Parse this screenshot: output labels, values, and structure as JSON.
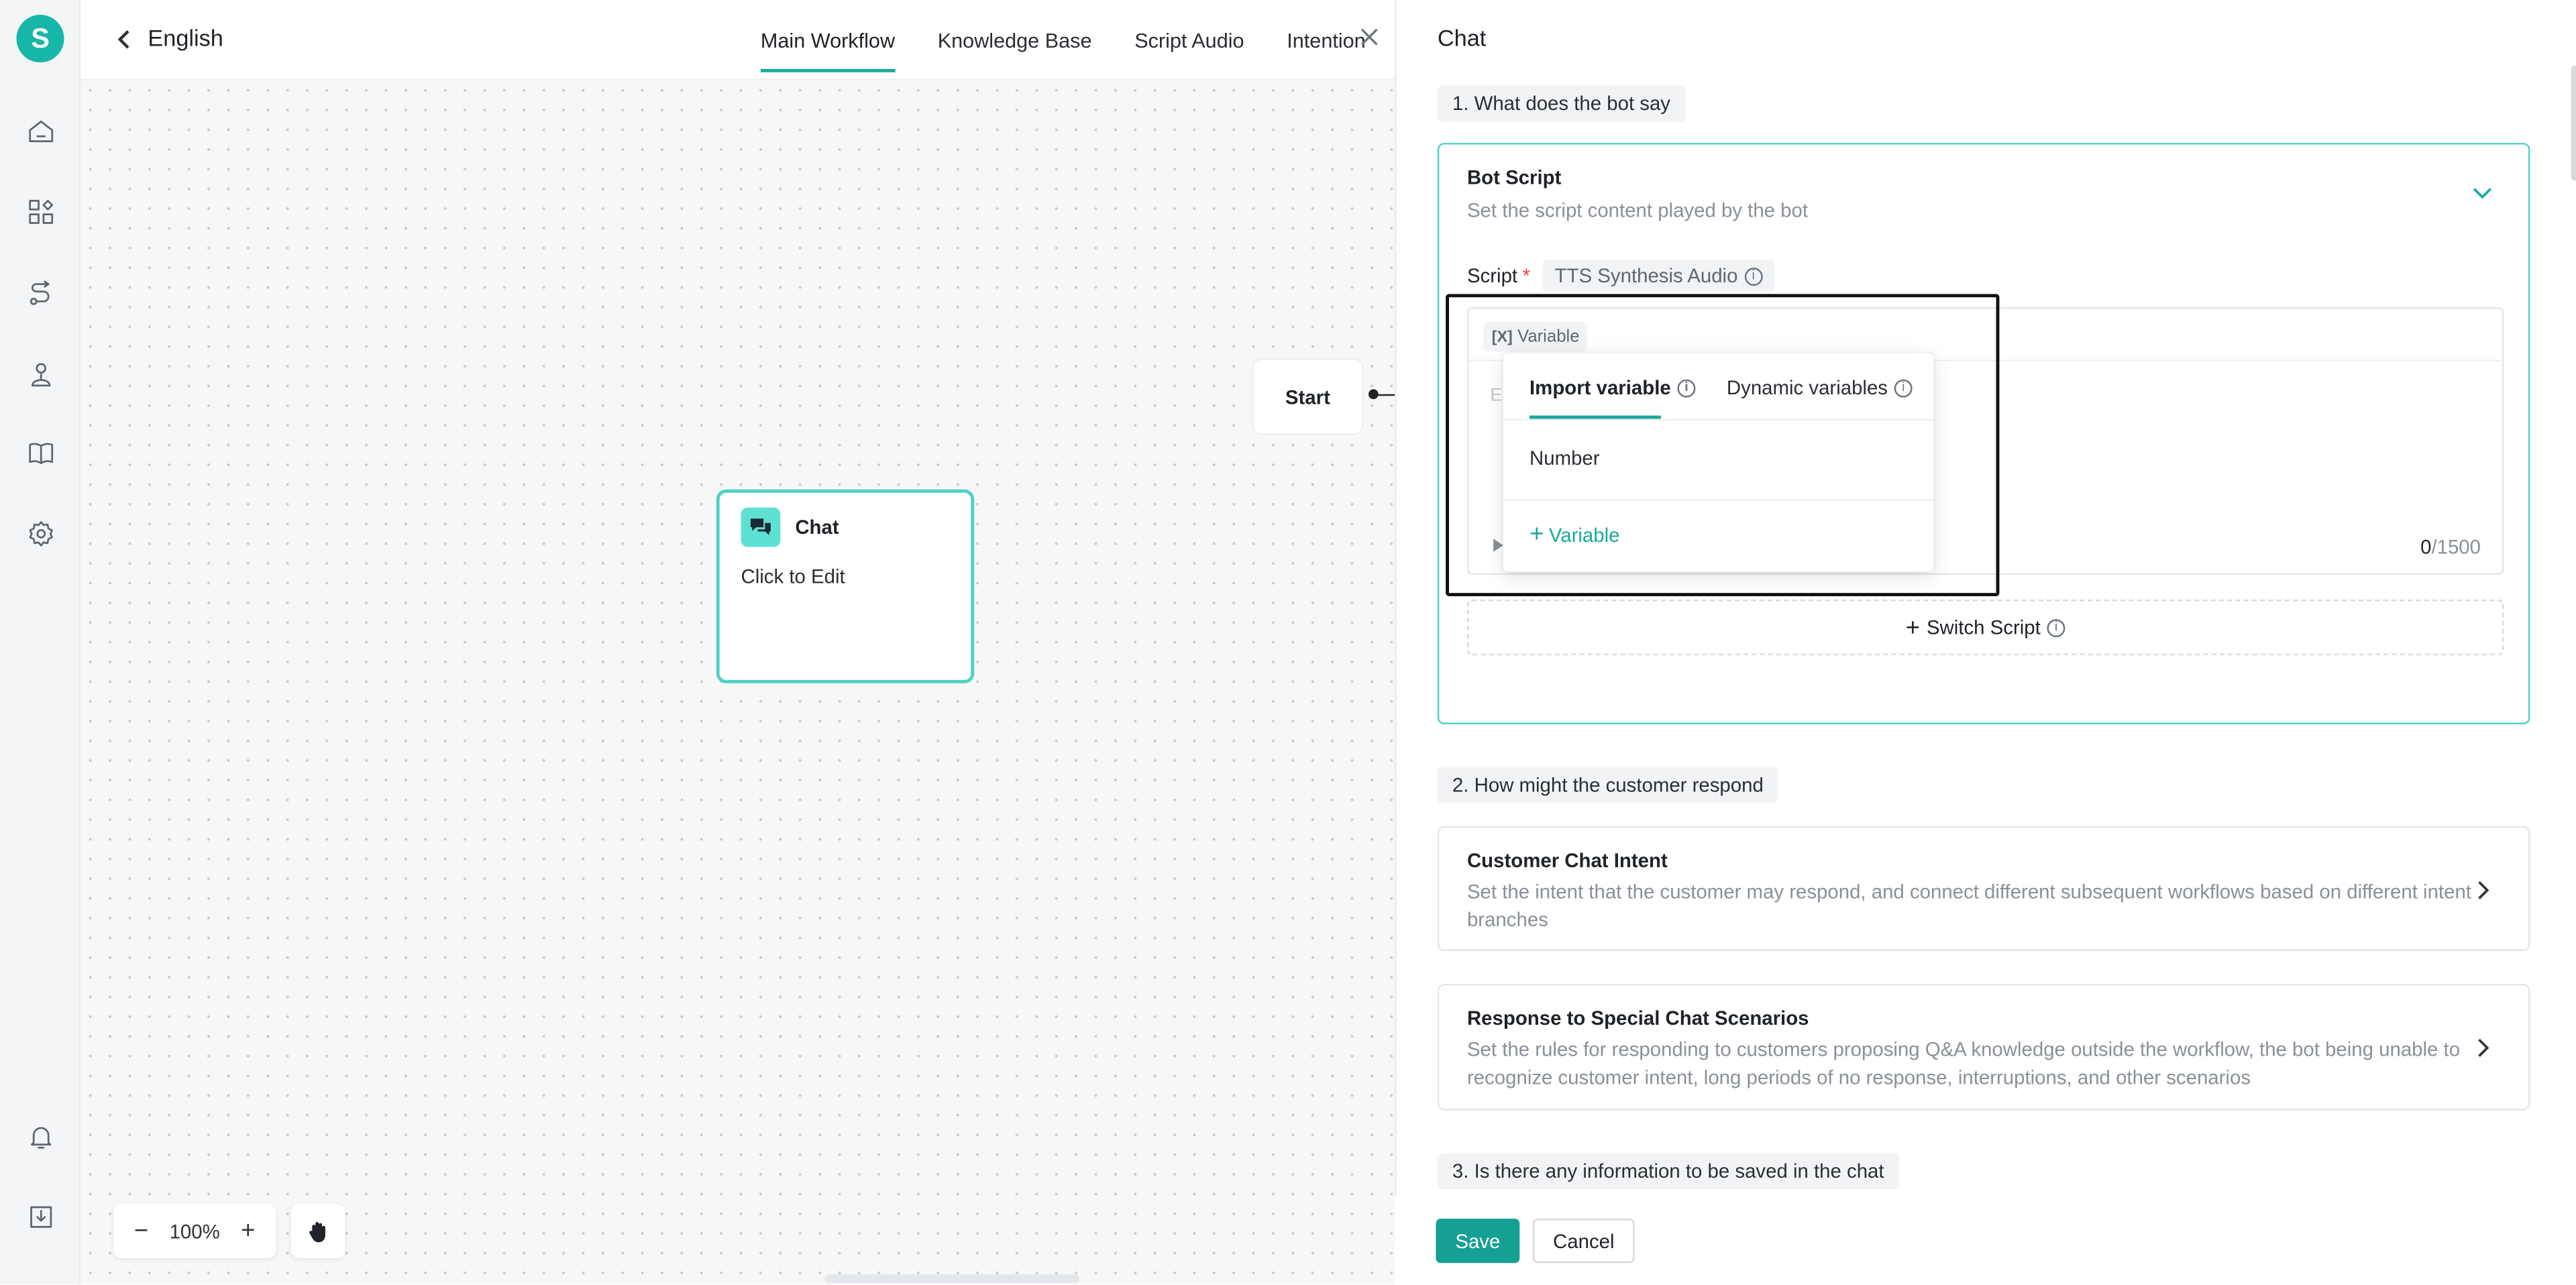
{
  "app": {
    "logo_letter": "S",
    "accent_color": "#1aa99c"
  },
  "sidebar": {
    "icons": [
      "home-icon",
      "apps-icon",
      "workflow-icon",
      "contacts-icon",
      "knowledge-book-icon",
      "settings-gear-icon",
      "bell-icon",
      "download-icon"
    ]
  },
  "header": {
    "back_label": "English",
    "tabs": [
      {
        "label": "Main Workflow",
        "active": true
      },
      {
        "label": "Knowledge Base",
        "active": false
      },
      {
        "label": "Script Audio",
        "active": false
      },
      {
        "label": "Intention",
        "active": false
      }
    ]
  },
  "canvas": {
    "start_node": "Start",
    "chat_node": {
      "title": "Chat",
      "body": "Click to Edit"
    },
    "zoom": {
      "minus": "−",
      "value": "100%",
      "plus": "+"
    }
  },
  "panel": {
    "title": "Chat",
    "step1": "1. What does the bot say",
    "bot_script": {
      "title": "Bot Script",
      "desc": "Set the script content played by the bot",
      "script_label": "Script",
      "required_mark": "*",
      "tts_chip": "TTS Synthesis Audio",
      "variable_chip_prefix": "[X]",
      "variable_chip": "Variable",
      "placeholder": "Er",
      "count_current": "0",
      "count_max": "/1500",
      "switch_label": "Switch Script"
    },
    "popover": {
      "tabs": [
        "Import variable",
        "Dynamic variables"
      ],
      "items": [
        "Number"
      ],
      "add_label": "Variable"
    },
    "step2": "2. How might the customer respond",
    "intent_card": {
      "title": "Customer Chat Intent",
      "desc": "Set the intent that the customer may respond, and connect different subsequent workflows based on different intent branches"
    },
    "special_card": {
      "title": "Response to Special Chat Scenarios",
      "desc": "Set the rules for responding to customers proposing Q&A knowledge outside the workflow, the bot being unable to recognize customer intent, long periods of no response, interruptions, and other scenarios"
    },
    "step3": "3. Is there any information to be saved in the chat"
  },
  "footer": {
    "save": "Save",
    "cancel": "Cancel"
  }
}
